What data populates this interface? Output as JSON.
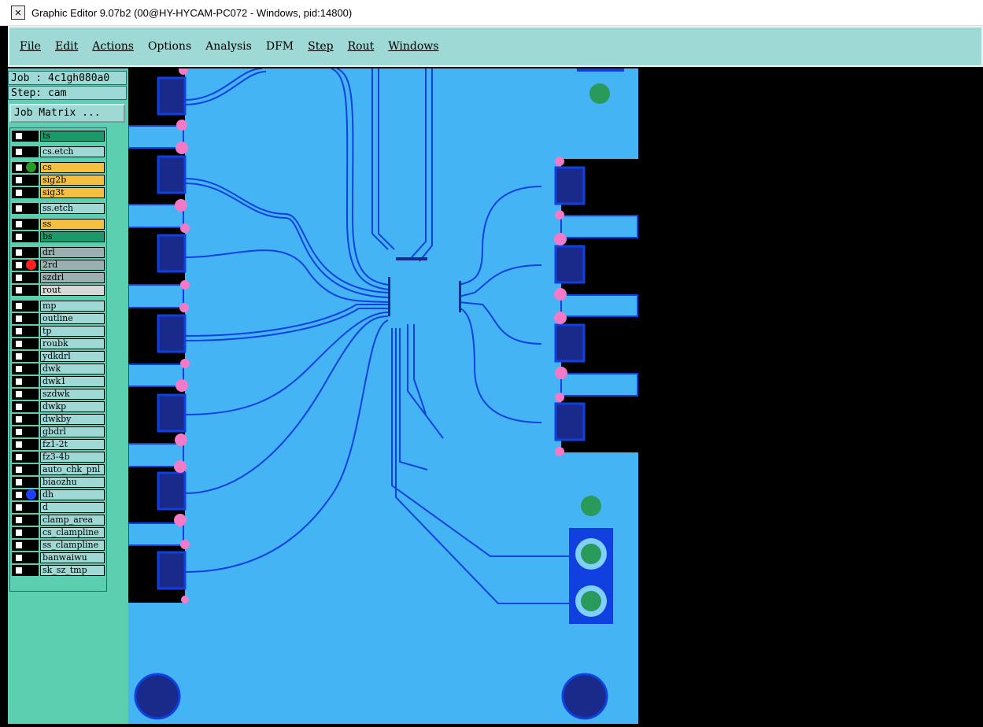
{
  "window": {
    "title": "Graphic Editor 9.07b2 (00@HY-HYCAM-PC072 - Windows, pid:14800)",
    "icon": "graphic-editor-icon"
  },
  "menu": [
    {
      "label": "File",
      "underline": true
    },
    {
      "label": "Edit",
      "underline": true
    },
    {
      "label": "Actions",
      "underline": true
    },
    {
      "label": "Options",
      "underline": false
    },
    {
      "label": "Analysis",
      "underline": false
    },
    {
      "label": "DFM",
      "underline": false
    },
    {
      "label": "Step",
      "underline": true
    },
    {
      "label": "Rout",
      "underline": true
    },
    {
      "label": "Windows",
      "underline": true
    }
  ],
  "job": {
    "label": "Job : 4c1gh080a0",
    "step": "Step: cam",
    "matrix_button": "Job Matrix ..."
  },
  "layers": [
    {
      "name": "ts",
      "color": "#1a9a6a",
      "dot": null
    },
    {
      "name": "cs.etch",
      "color": "#9ed9d5",
      "dot": null
    },
    {
      "name": "cs",
      "color": "#f5c040",
      "dot": "#2a9a2a"
    },
    {
      "name": "sig2b",
      "color": "#f5c040",
      "dot": null
    },
    {
      "name": "sig3t",
      "color": "#f5c040",
      "dot": null
    },
    {
      "name": "ss.etch",
      "color": "#9ed9d5",
      "dot": null
    },
    {
      "name": "ss",
      "color": "#f5c040",
      "dot": null
    },
    {
      "name": "bs",
      "color": "#1a9a6a",
      "dot": null
    },
    {
      "name": "drl",
      "color": "#9bb0b0",
      "dot": null
    },
    {
      "name": "2rd",
      "color": "#9bb0b0",
      "dot": "#ff2020"
    },
    {
      "name": "szdrl",
      "color": "#9bb0b0",
      "dot": null
    },
    {
      "name": "rout",
      "color": "#d8d8d8",
      "dot": null
    },
    {
      "name": "mp",
      "color": "#9ed9d5",
      "dot": null
    },
    {
      "name": "outline",
      "color": "#9ed9d5",
      "dot": null
    },
    {
      "name": "tp",
      "color": "#9ed9d5",
      "dot": null
    },
    {
      "name": "roubk",
      "color": "#9ed9d5",
      "dot": null
    },
    {
      "name": "ydkdrl",
      "color": "#9ed9d5",
      "dot": null
    },
    {
      "name": "dwk",
      "color": "#9ed9d5",
      "dot": null
    },
    {
      "name": "dwk1",
      "color": "#9ed9d5",
      "dot": null
    },
    {
      "name": "szdwk",
      "color": "#9ed9d5",
      "dot": null
    },
    {
      "name": "dwkp",
      "color": "#9ed9d5",
      "dot": null
    },
    {
      "name": "dwkby",
      "color": "#9ed9d5",
      "dot": null
    },
    {
      "name": "gbdrl",
      "color": "#9ed9d5",
      "dot": null
    },
    {
      "name": "fz1-2t",
      "color": "#9ed9d5",
      "dot": null
    },
    {
      "name": "fz3-4b",
      "color": "#9ed9d5",
      "dot": null
    },
    {
      "name": "auto_chk_pnl",
      "color": "#9ed9d5",
      "dot": null
    },
    {
      "name": "biaozhu",
      "color": "#9ed9d5",
      "dot": null
    },
    {
      "name": "dh",
      "color": "#9ed9d5",
      "dot": "#2040ff"
    },
    {
      "name": "d",
      "color": "#9ed9d5",
      "dot": null
    },
    {
      "name": "clamp_area",
      "color": "#9ed9d5",
      "dot": null
    },
    {
      "name": "cs_clampline",
      "color": "#9ed9d5",
      "dot": null
    },
    {
      "name": "ss_clampline",
      "color": "#9ed9d5",
      "dot": null
    },
    {
      "name": "banwaiwu",
      "color": "#9ed9d5",
      "dot": null
    },
    {
      "name": "sk_sz_tmp",
      "color": "#9ed9d5",
      "dot": null
    }
  ],
  "colors": {
    "board": "#45b4f5",
    "trace": "#1040e0",
    "pad": "#1a2a8a",
    "menu": "#9ed9d5",
    "panel": "#5ccfb0"
  }
}
